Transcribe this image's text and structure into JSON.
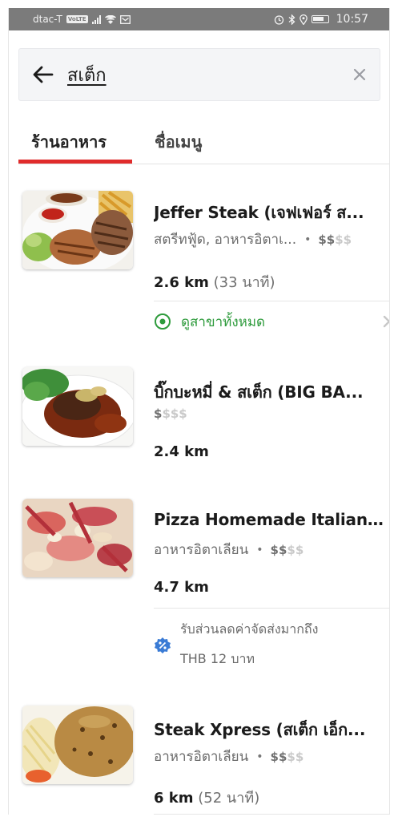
{
  "status_bar": {
    "carrier": "dtac-T",
    "volte": "VoLTE",
    "time": "10:57"
  },
  "search": {
    "query": "สเต็ก"
  },
  "tabs": [
    {
      "label": "ร้านอาหาร",
      "active": true
    },
    {
      "label": "ชื่อเมนู",
      "active": false
    }
  ],
  "accent_color": "#e02b2b",
  "link_color": "#2e9b3c",
  "restaurants": [
    {
      "name": "Jeffer Steak (เจฟเฟอร์ ส...",
      "cuisine": "สตรีทฟู้ด, อาหารอิตาเ...",
      "separator": "•",
      "price_on": "$$",
      "price_off": "$$",
      "distance": "2.6 km",
      "time": "(33 นาที)",
      "branches_label": "ดูสาขาทั้งหมด"
    },
    {
      "name": "บิ๊กบะหมี่ & สเต็ก (BIG BA...",
      "price_on": "$",
      "price_off": "$$$",
      "distance": "2.4 km"
    },
    {
      "name": "Pizza Homemade Italian...",
      "cuisine": "อาหารอิตาเลียน",
      "separator": "•",
      "price_on": "$$",
      "price_off": "$$",
      "distance": "4.7 km",
      "promo_line1": "รับส่วนลดค่าจัดส่งมากถึง",
      "promo_line2": "THB 12 บาท"
    },
    {
      "name": "Steak Xpress (สเต็ก เอ็ก...",
      "cuisine": "อาหารอิตาเลียน",
      "separator": "•",
      "price_on": "$$",
      "price_off": "$$",
      "distance": "6 km",
      "time": "(52 นาที)"
    }
  ]
}
